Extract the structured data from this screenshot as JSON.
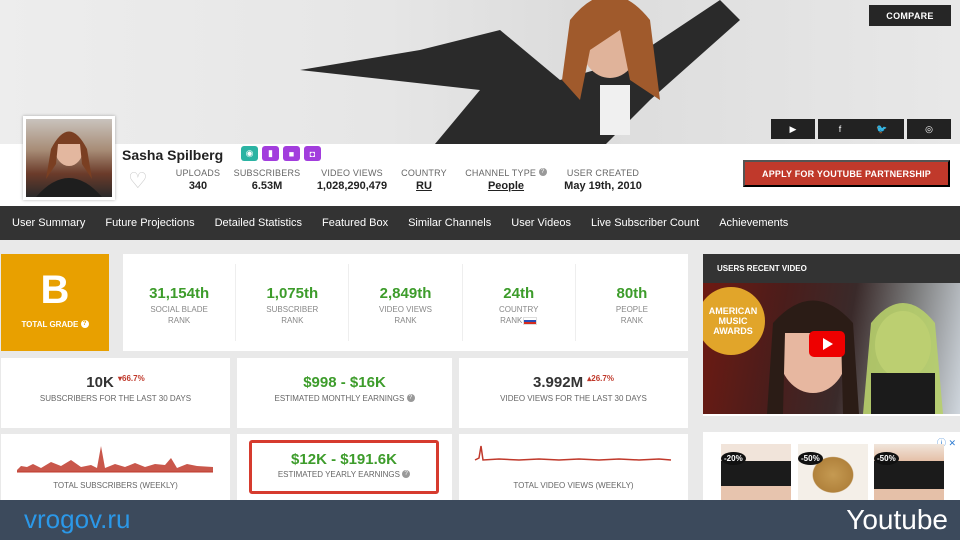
{
  "header": {
    "compare_label": "COMPARE",
    "social": [
      {
        "icon": "youtube-icon",
        "glyph": "▶"
      },
      {
        "icon": "facebook-icon",
        "glyph": "f"
      },
      {
        "icon": "twitter-icon",
        "glyph": "🐦"
      },
      {
        "icon": "instagram-icon",
        "glyph": "◎"
      }
    ]
  },
  "profile": {
    "name": "Sasha Spilberg",
    "badges": [
      {
        "icon": "eye-icon",
        "color": "#2bb3a3",
        "glyph": "◉"
      },
      {
        "icon": "stats-icon",
        "color": "#a23ddd",
        "glyph": "▮"
      },
      {
        "icon": "video-icon",
        "color": "#a23ddd",
        "glyph": "■"
      },
      {
        "icon": "gift-icon",
        "color": "#a23ddd",
        "glyph": "◘"
      }
    ],
    "uploads_label": "UPLOADS",
    "uploads": "340",
    "subs_label": "SUBSCRIBERS",
    "subs": "6.53M",
    "views_label": "VIDEO VIEWS",
    "views": "1,028,290,479",
    "country_label": "COUNTRY",
    "country": "RU",
    "type_label": "CHANNEL TYPE",
    "type": "People",
    "created_label": "USER CREATED",
    "created": "May 19th, 2010",
    "apply_label": "APPLY FOR YOUTUBE PARTNERSHIP"
  },
  "nav": [
    "User Summary",
    "Future Projections",
    "Detailed Statistics",
    "Featured Box",
    "Similar Channels",
    "User Videos",
    "Live Subscriber Count",
    "Achievements"
  ],
  "grade": {
    "letter": "B",
    "label": "TOTAL GRADE"
  },
  "ranks": [
    {
      "num": "31,154th",
      "l1": "SOCIAL BLADE",
      "l2": "RANK"
    },
    {
      "num": "1,075th",
      "l1": "SUBSCRIBER",
      "l2": "RANK"
    },
    {
      "num": "2,849th",
      "l1": "VIDEO VIEWS",
      "l2": "RANK"
    },
    {
      "num": "24th",
      "l1": "COUNTRY",
      "l2": "RANK"
    },
    {
      "num": "80th",
      "l1": "PEOPLE",
      "l2": "RANK"
    }
  ],
  "stats": {
    "subs30": "10K",
    "subs30_change": "▾66.7%",
    "subs30_label": "SUBSCRIBERS FOR THE LAST 30 DAYS",
    "monthly": "$998 - $16K",
    "monthly_label": "ESTIMATED MONTHLY EARNINGS",
    "views30": "3.992M",
    "views30_change": "▴26.7%",
    "views30_label": "VIDEO VIEWS FOR THE LAST 30 DAYS",
    "yearly": "$12K - $191.6K",
    "yearly_label": "ESTIMATED YEARLY EARNINGS",
    "subs_weekly_label": "TOTAL SUBSCRIBERS (WEEKLY)",
    "views_weekly_label": "TOTAL VIDEO VIEWS (WEEKLY)"
  },
  "recent": {
    "heading": "USERS RECENT VIDEO",
    "thumb_text": "AMERICAN MUSIC AWARDS"
  },
  "ads": [
    "-20%",
    "-50%",
    "-50%"
  ],
  "footer": {
    "site": "vrogov.ru",
    "label": "Youtube"
  },
  "colors": {
    "accent_red": "#c0392b",
    "rank_green": "#3d9c2b",
    "grade_orange": "#e8a000",
    "nav_dark": "#333333"
  }
}
